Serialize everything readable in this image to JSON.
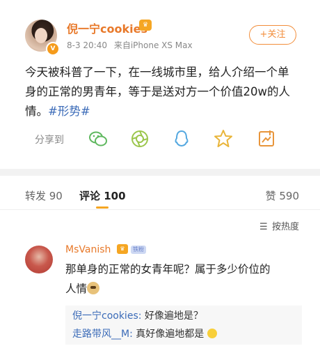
{
  "post": {
    "username": "倪一宁cookies",
    "date": "8-3 20:40",
    "source": "来自iPhone XS Max",
    "follow_label": "+关注",
    "text_line1": "今天被科普了一下，在一线城市里，给人介绍一个单",
    "text_line2": "身的正常的男青年，等于是送对方一个价值20w的人",
    "text_line3": "情。",
    "hashtag": "#形势#"
  },
  "share": {
    "label": "分享到",
    "targets": [
      "wechat-icon",
      "moments-icon",
      "qq-icon",
      "qzone-icon",
      "save-image-icon"
    ]
  },
  "tabs": {
    "repost": "转发 90",
    "comment": "评论 100",
    "like": "赞 590"
  },
  "sort_label": "按热度",
  "comment": {
    "username": "MsVanish",
    "badge": "铁粉",
    "text_line1": "那单身的正常的女青年呢？属于多少价位的",
    "text_line2": "人情",
    "replies": [
      {
        "user": "倪一宁cookies:",
        "text": " 好像遍地是？"
      },
      {
        "user": "走路带风__M:",
        "text": " 真好像遍地都是"
      }
    ]
  },
  "colors": {
    "username": "#e8792a",
    "link": "#3b6bb8",
    "accent": "#f5a623"
  }
}
